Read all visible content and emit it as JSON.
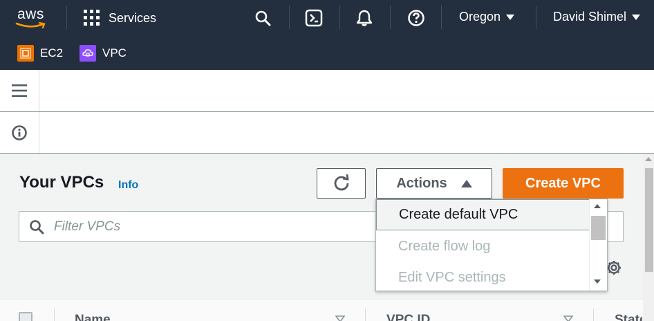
{
  "topnav": {
    "logo_text": "aws",
    "services_label": "Services",
    "region": "Oregon",
    "user": "David Shimel",
    "favorites": [
      {
        "label": "EC2",
        "color": "#ed7100"
      },
      {
        "label": "VPC",
        "color": "#8c4fff"
      }
    ],
    "icons": [
      "search-icon",
      "cloudshell-icon",
      "notifications-icon",
      "help-icon"
    ]
  },
  "header": {
    "title": "Your VPCs",
    "info_link": "Info",
    "actions_label": "Actions",
    "create_label": "Create VPC"
  },
  "search": {
    "placeholder": "Filter VPCs",
    "value": ""
  },
  "actions_menu": {
    "items": [
      {
        "label": "Create default VPC",
        "state": "highlighted"
      },
      {
        "label": "Create flow log",
        "state": "disabled"
      },
      {
        "label": "Edit VPC settings",
        "state": "disabled"
      }
    ]
  },
  "table": {
    "columns": [
      "Name",
      "VPC ID",
      "State"
    ]
  },
  "colors": {
    "nav_bg": "#232f3e",
    "primary": "#ec7211",
    "link": "#0073bb"
  }
}
